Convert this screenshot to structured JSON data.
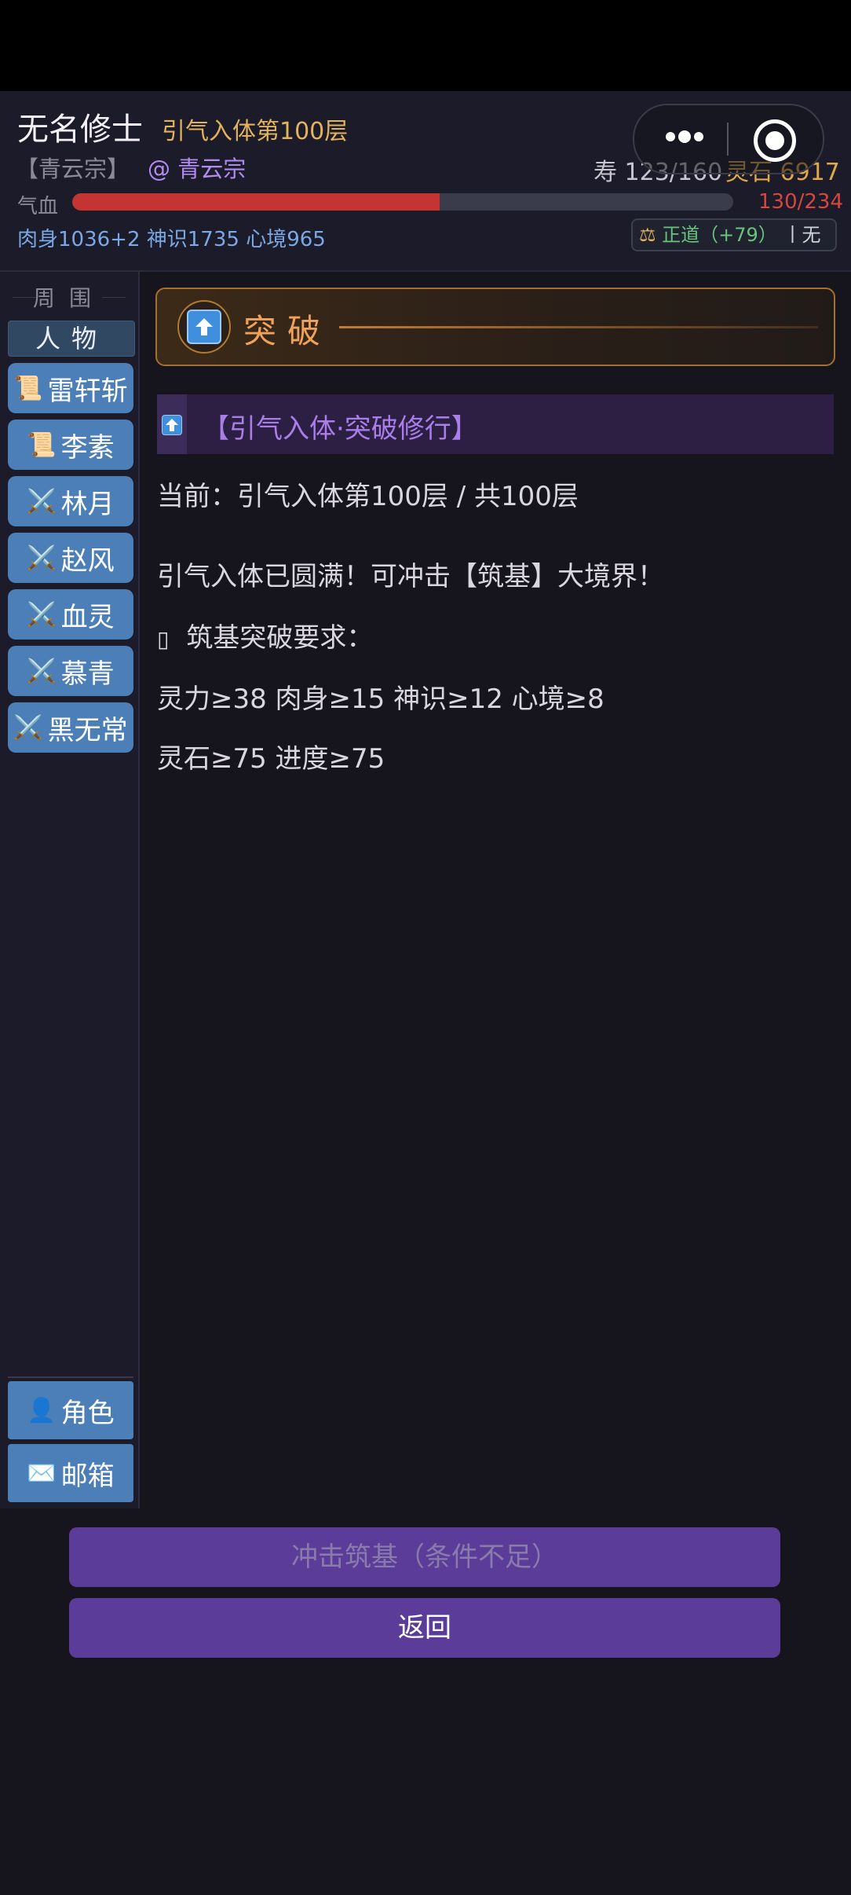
{
  "header": {
    "player_name": "无名修士",
    "realm": "引气入体第100层",
    "sect": "【青云宗】",
    "sect_link": "@ 青云宗",
    "lifespan": "寿 123/160",
    "spirit_stones": "灵石 6917",
    "hp_label": "气血",
    "hp_value": "130/234",
    "hp_ratio": 0.556,
    "stats": "肉身1036+2 神识1735 心境965",
    "alignment_scale_icon": "balance-scale-icon",
    "alignment": "正道（+79）",
    "alignment_extra": "丨无"
  },
  "sidebar": {
    "title": "周围",
    "section": "人物",
    "characters": [
      {
        "icon": "scroll-icon",
        "glyph": "📜",
        "name": "雷轩斩"
      },
      {
        "icon": "scroll-icon",
        "glyph": "📜",
        "name": "李素"
      },
      {
        "icon": "crossed-swords-icon",
        "glyph": "⚔️",
        "name": "林月"
      },
      {
        "icon": "crossed-swords-icon",
        "glyph": "⚔️",
        "name": "赵风"
      },
      {
        "icon": "crossed-swords-icon",
        "glyph": "⚔️",
        "name": "血灵"
      },
      {
        "icon": "crossed-swords-icon",
        "glyph": "⚔️",
        "name": "慕青"
      },
      {
        "icon": "crossed-swords-icon",
        "glyph": "⚔️",
        "name": "黑无常"
      }
    ],
    "bottom_buttons": [
      {
        "icon": "person-icon",
        "glyph": "👤",
        "label": "角色"
      },
      {
        "icon": "envelope-icon",
        "glyph": "✉️",
        "label": "邮箱"
      }
    ]
  },
  "panel": {
    "icon": "up-arrow-icon",
    "title": "突破",
    "section_title": "【引气入体·突破修行】",
    "current": "当前：引气入体第100层 / 共100层",
    "message": "引气入体已圆满！可冲击【筑基】大境界！",
    "req_icon": "▯",
    "requirements_title": "筑基突破要求：",
    "req_line1": "灵力≥38 肉身≥15 神识≥12 心境≥8",
    "req_line2": "灵石≥75 进度≥75"
  },
  "actions": {
    "breakthrough": "冲击筑基（条件不足）",
    "back": "返回"
  },
  "colors": {
    "accent_purple": "#5b3d99",
    "gold": "#e3b25c",
    "hp_red": "#c33433",
    "sidebar_button": "#4c7fb8"
  }
}
